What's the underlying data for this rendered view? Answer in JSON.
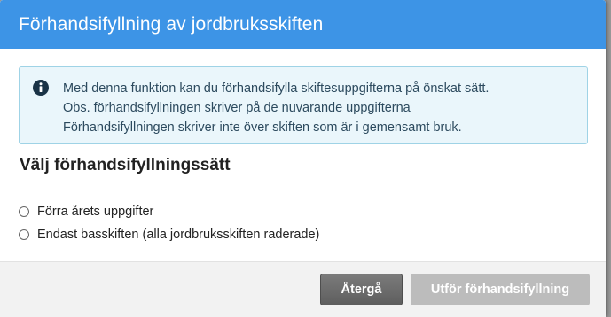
{
  "dialog": {
    "title": "Förhandsifyllning av jordbruksskiften",
    "colors": {
      "header": "#3d94e6",
      "info_background": "#eaf6fb",
      "info_border": "#9fd3e6",
      "info_icon": "#1a3346",
      "back_button": "#6a6a6a",
      "execute_button_disabled": "#bcbcbc"
    }
  },
  "info": {
    "icon": "info-circle-icon",
    "lines": [
      "Med denna funktion kan du förhandsifylla skiftesuppgifterna på önskat sätt.",
      "Obs. förhandsifyllningen skriver på de nuvarande uppgifterna",
      "Förhandsifyllningen skriver inte över skiften som är i gemensamt bruk."
    ]
  },
  "options": {
    "heading": "Välj förhandsifyllningssätt",
    "items": [
      {
        "label": "Förra årets uppgifter",
        "selected": false
      },
      {
        "label": "Endast basskiften (alla jordbruksskiften raderade)",
        "selected": false
      }
    ]
  },
  "footer": {
    "back_label": "Återgå",
    "execute_label": "Utför förhandsifyllning",
    "execute_disabled": true
  }
}
